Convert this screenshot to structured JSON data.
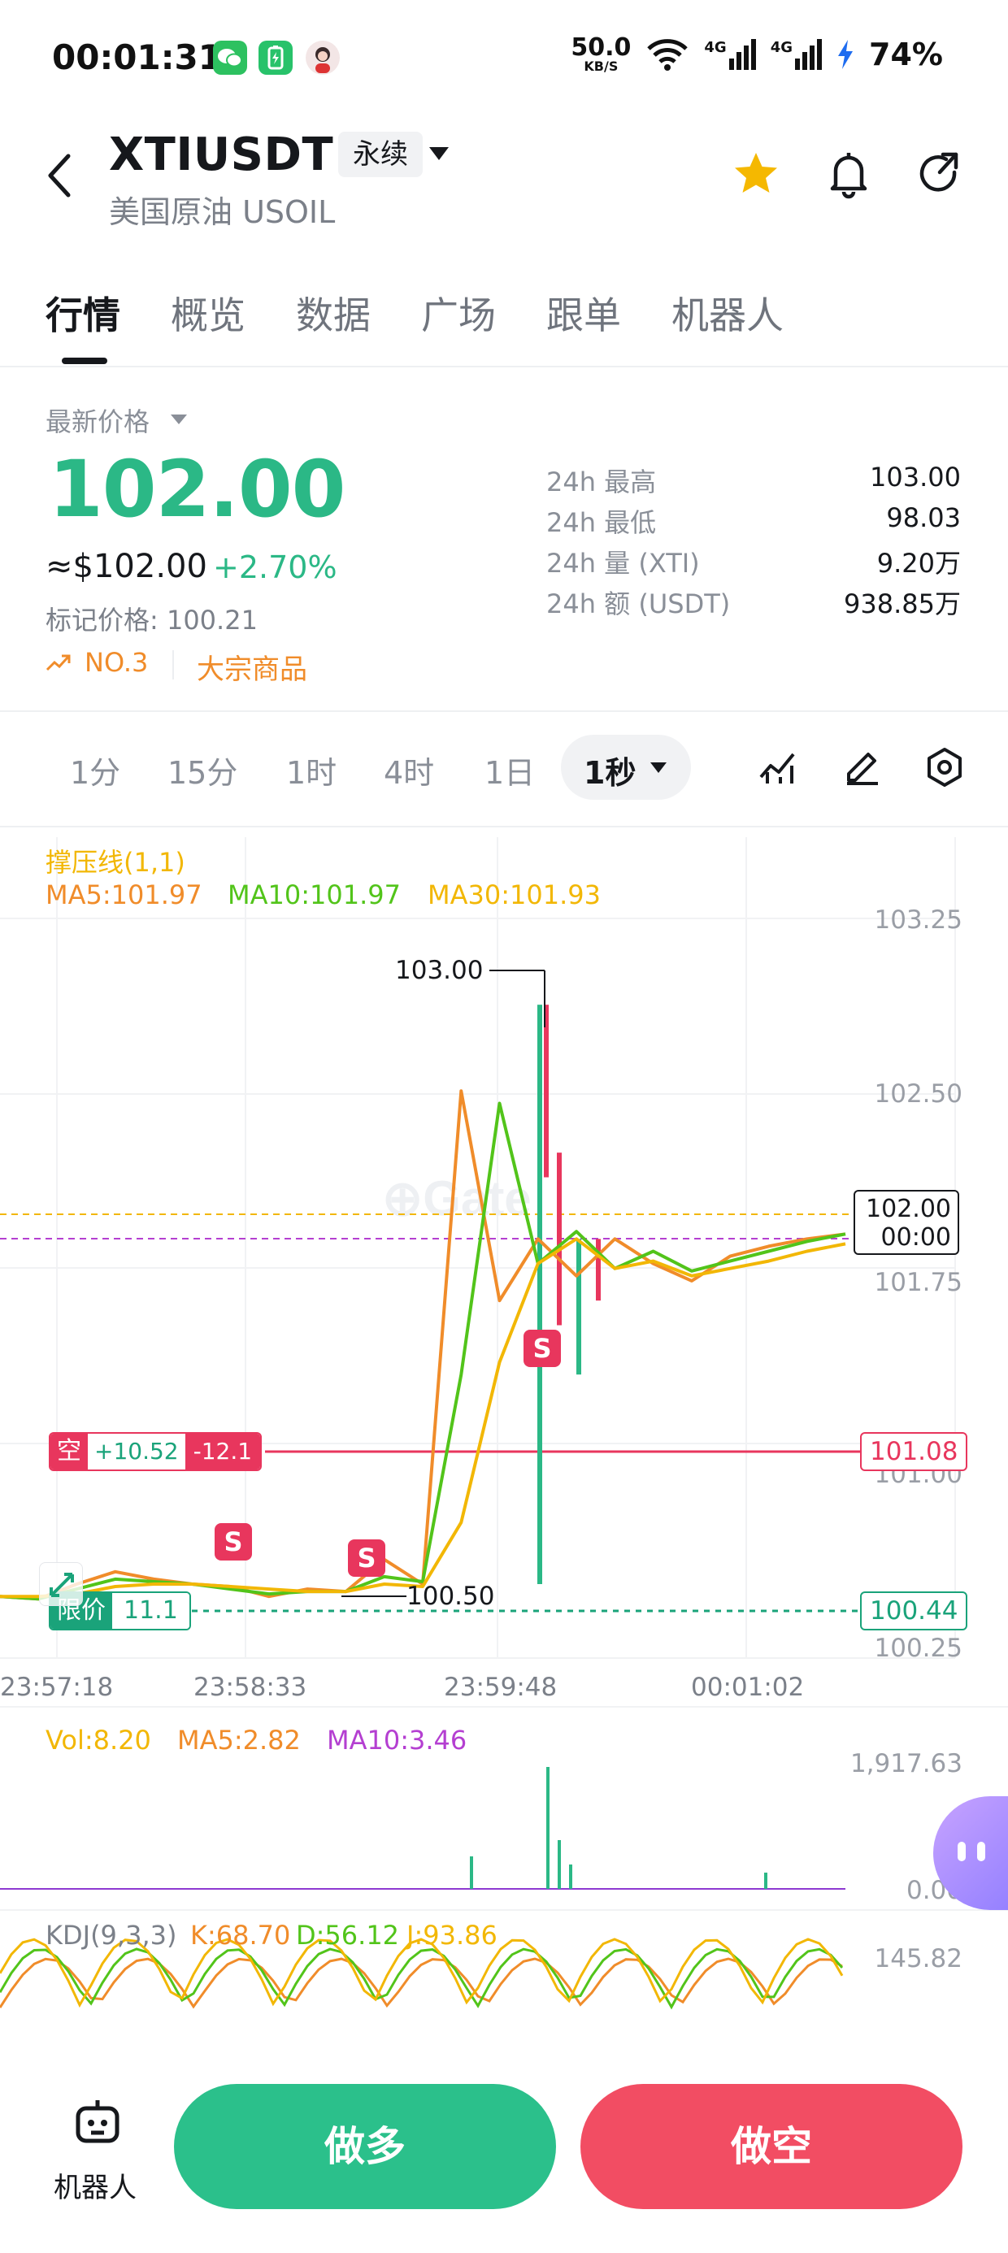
{
  "status_bar": {
    "time": "00:01:31",
    "net_speed_value": "50.0",
    "net_speed_unit": "KB/S",
    "signal1": "4G",
    "signal2": "4G",
    "battery": "74%",
    "icons": [
      "wechat-icon",
      "battery-app-icon",
      "avatar-icon",
      "wifi-icon",
      "signal-icon",
      "charging-icon"
    ]
  },
  "header": {
    "symbol": "XTIUSDT",
    "contract_type": "永续",
    "subtitle": "美国原油 USOIL",
    "icons": [
      "back-icon",
      "star-icon",
      "bell-icon",
      "share-icon"
    ],
    "star_color": "#f5b800"
  },
  "tabs": [
    {
      "label": "行情",
      "active": true
    },
    {
      "label": "概览",
      "active": false
    },
    {
      "label": "数据",
      "active": false
    },
    {
      "label": "广场",
      "active": false
    },
    {
      "label": "跟单",
      "active": false
    },
    {
      "label": "机器人",
      "active": false
    }
  ],
  "price": {
    "latest_label": "最新价格",
    "last": "102.00",
    "usd": "≈$102.00",
    "change_pct": "+2.70%",
    "mark_price": "标记价格: 100.21",
    "rank": "NO.3",
    "category": "大宗商品",
    "up_color": "#2bb886"
  },
  "stats": [
    {
      "label": "24h  最高",
      "value": "103.00"
    },
    {
      "label": "24h  最低",
      "value": "98.03"
    },
    {
      "label": "24h  量 (XTI)",
      "value": "9.20万"
    },
    {
      "label": "24h  额 (USDT)",
      "value": "938.85万"
    }
  ],
  "timeframes": {
    "items": [
      "1分",
      "15分",
      "1时",
      "4时",
      "1日"
    ],
    "active": "1秒"
  },
  "chart": {
    "indicator_title": "撑压线(1,1)",
    "ma5": "MA5:101.97",
    "ma10": "MA10:101.97",
    "ma30": "MA30:101.93",
    "y_ticks": [
      "103.25",
      "102.50",
      "101.75",
      "101.00",
      "100.25"
    ],
    "high_marker": "103.00",
    "low_marker": "100.50",
    "current_price_box": "102.00",
    "current_countdown": "00:00",
    "short_position": {
      "side": "空",
      "pnl": "+10.52",
      "pnl_pct": "-12.1",
      "price": "101.08"
    },
    "limit_order": {
      "label": "限价",
      "qty": "11.1",
      "price": "100.44"
    },
    "signal_marker": "S",
    "time_ticks": [
      "23:57:18",
      "23:58:33",
      "23:59:48",
      "00:01:02"
    ],
    "volume": {
      "vol": "Vol:8.20",
      "ma5": "MA5:2.82",
      "ma10": "MA10:3.46",
      "max": "1,917.63",
      "min": "0.00"
    },
    "kdj": {
      "title": "KDJ(9,3,3)",
      "k": "K:68.70",
      "d": "D:56.12",
      "j": "J:93.86",
      "max": "145.82"
    },
    "colors": {
      "ma5": "#f08c2a",
      "ma10": "#52c41a",
      "ma30": "#f2b705",
      "vol_ma10": "#b43fd1",
      "short_line": "#e8365d",
      "limit_line": "#1aa37a"
    }
  },
  "chart_data": {
    "type": "line",
    "title": "",
    "x_ticks": [
      "23:57:18",
      "23:58:33",
      "23:59:48",
      "00:01:02"
    ],
    "ylim": [
      100.25,
      103.25
    ],
    "series": [
      {
        "name": "MA5",
        "values": [
          100.5,
          100.49,
          100.55,
          100.6,
          100.57,
          100.55,
          100.54,
          100.5,
          100.53,
          100.52,
          100.65,
          100.55,
          102.55,
          101.7,
          101.95,
          101.8,
          101.95,
          101.85,
          101.78,
          101.88,
          101.92,
          101.95,
          101.97
        ]
      },
      {
        "name": "MA10",
        "values": [
          100.5,
          100.49,
          100.53,
          100.57,
          100.56,
          100.55,
          100.53,
          100.51,
          100.52,
          100.52,
          100.58,
          100.56,
          101.4,
          102.5,
          101.85,
          101.98,
          101.83,
          101.9,
          101.82,
          101.86,
          101.9,
          101.94,
          101.97
        ]
      },
      {
        "name": "MA30",
        "values": [
          100.5,
          100.5,
          100.51,
          100.54,
          100.55,
          100.55,
          100.54,
          100.53,
          100.52,
          100.52,
          100.55,
          100.54,
          100.8,
          101.45,
          101.85,
          101.95,
          101.83,
          101.86,
          101.8,
          101.83,
          101.86,
          101.9,
          101.93
        ]
      }
    ],
    "high": 103.0,
    "low": 100.5,
    "last": 102.0,
    "grid": true
  },
  "bottom": {
    "robot_label": "机器人",
    "long_label": "做多",
    "short_label": "做空"
  }
}
